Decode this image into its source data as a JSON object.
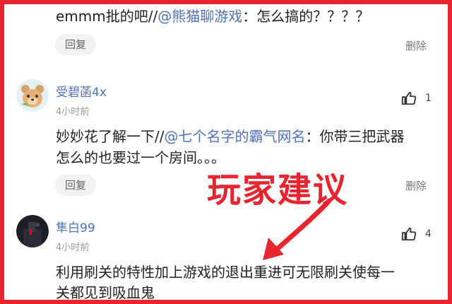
{
  "comments": [
    {
      "text_prefix": "emmm批的吧//",
      "mention": "@熊猫聊游戏",
      "text_suffix": "：怎么搞的？？？？",
      "reply_label": "回复",
      "delete_label": "删除"
    },
    {
      "username": "受碧菡4x",
      "time": "4小时前",
      "likes": "1",
      "text_prefix": "妙妙花了解一下//",
      "mention": "@七个名字的霸气网名",
      "text_suffix": "：你带三把武器",
      "text_line2": "怎么的也要过一个房间。。。",
      "reply_label": "回复",
      "delete_label": "删除"
    },
    {
      "username": "隼白99",
      "time": "4小时前",
      "likes": "4",
      "text_line1": "利用刷关的特性加上游戏的退出重进可无限刷关使每一",
      "text_line2": "关都见到吸血鬼"
    }
  ],
  "overlay": {
    "caption": "玩家建议",
    "color": "#e8252f"
  },
  "colors": {
    "mention": "#4f72b8",
    "frame": "#e8252f"
  }
}
